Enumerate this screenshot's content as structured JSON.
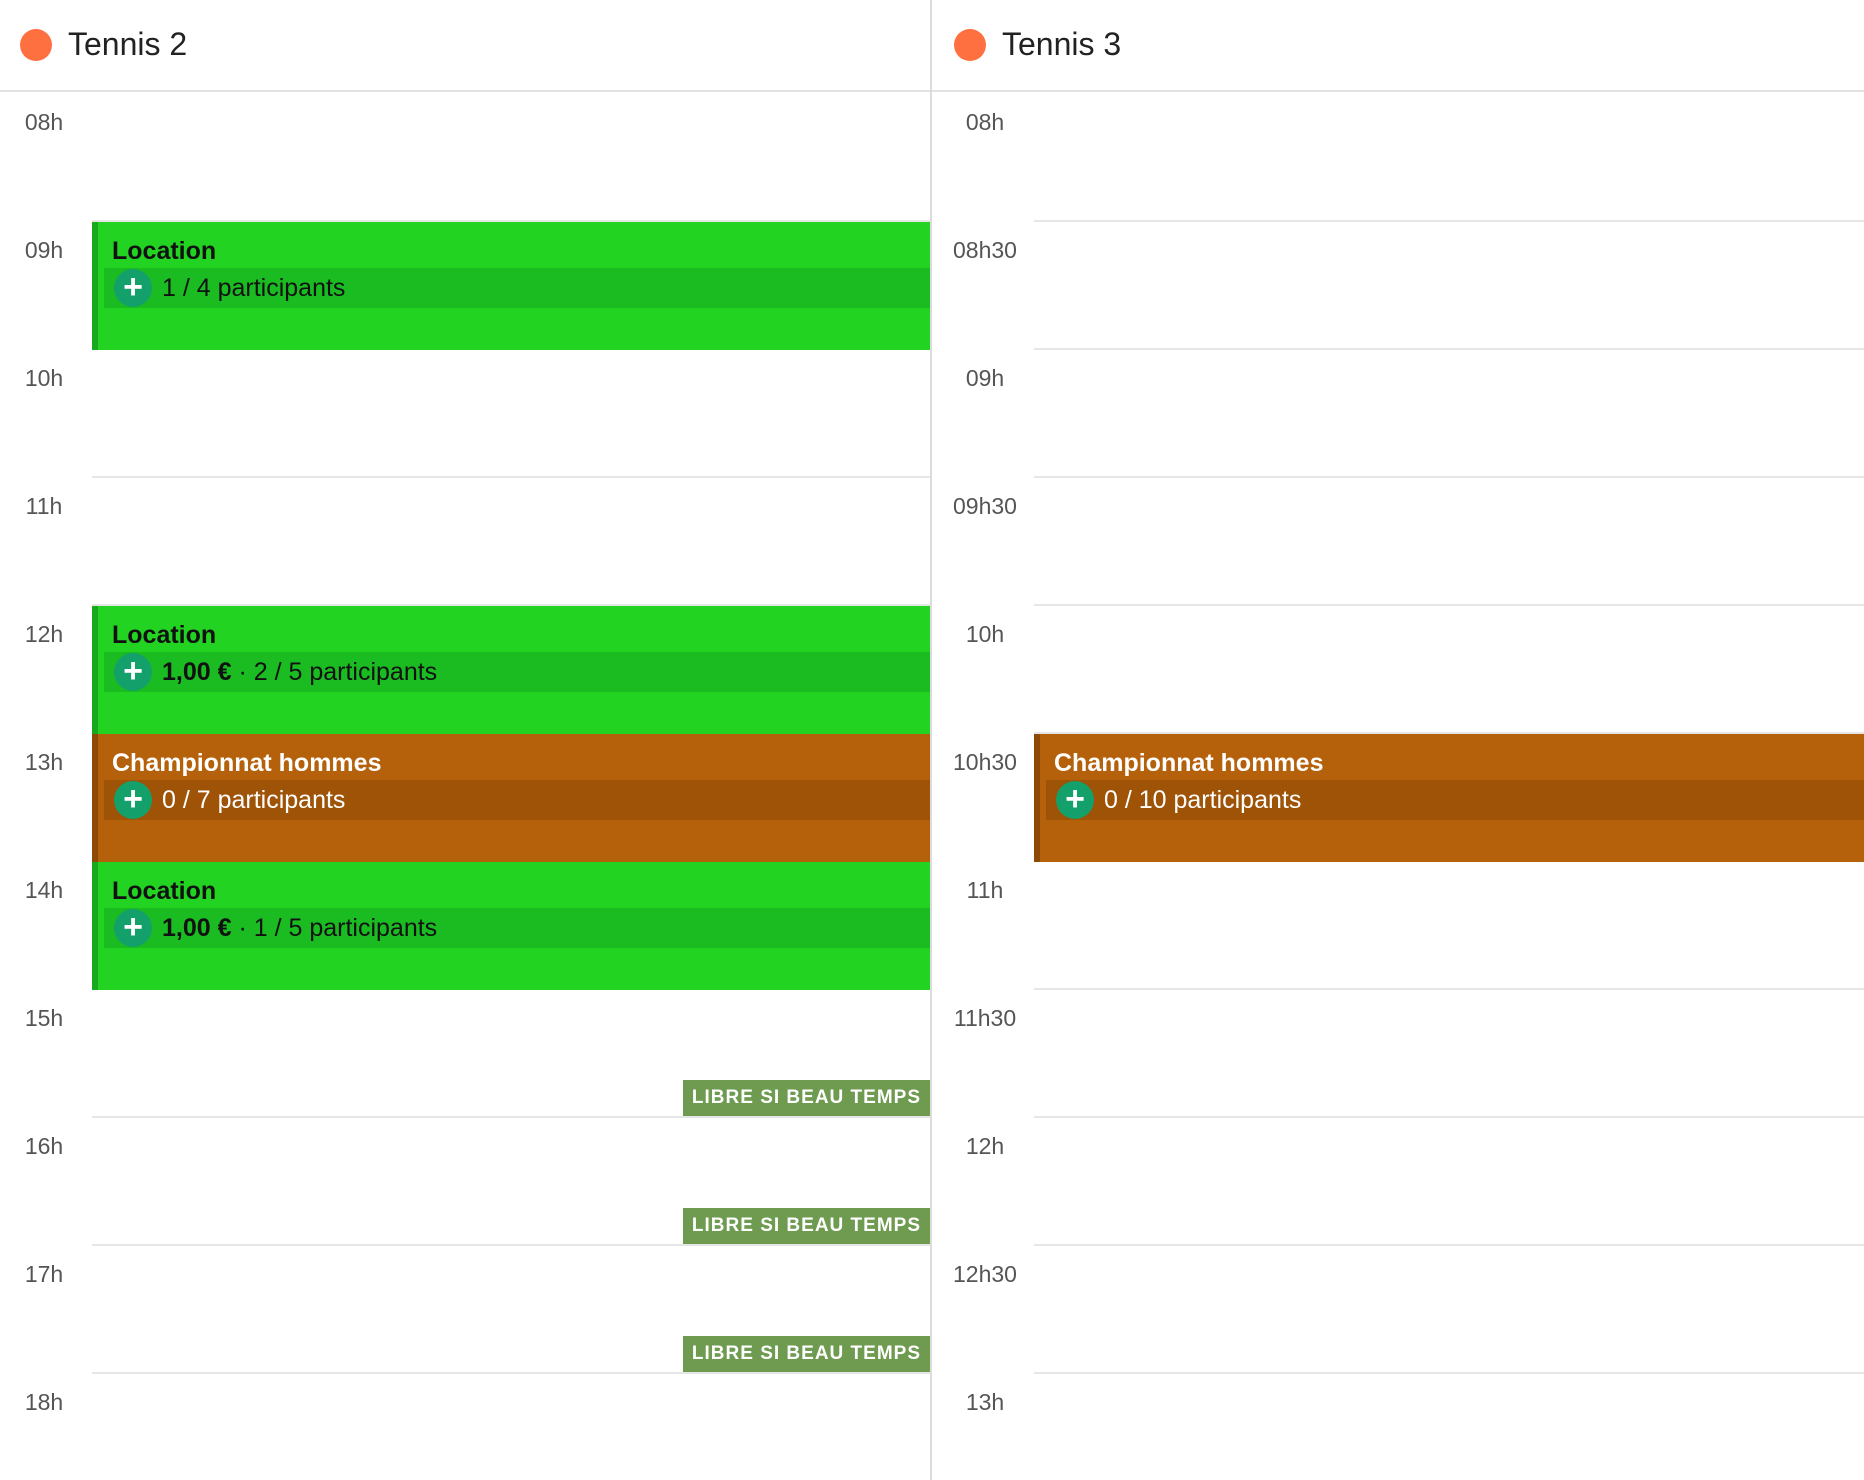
{
  "colors": {
    "resource_dot": "#ff7040",
    "location_bg": "#22d322",
    "location_row": "#1bbb22",
    "location_border": "#17a81e",
    "location_text": "#111111",
    "championnat_bg": "#b5600a",
    "championnat_row": "#9e5307",
    "championnat_border": "#8d4906",
    "championnat_text": "#ffffff",
    "badge_bg": "#6e9b50",
    "add_button": "#13a06a"
  },
  "columns": [
    {
      "name": "Tennis 2",
      "times": [
        "08h",
        "09h",
        "10h",
        "11h",
        "12h",
        "13h",
        "14h",
        "15h",
        "16h",
        "17h",
        "18h"
      ],
      "events": [
        {
          "kind": "location",
          "title": "Location",
          "price": "",
          "participants": "1 / 4 participants"
        },
        {
          "kind": "location",
          "title": "Location",
          "price": "1,00 €",
          "participants": " · 2 / 5 participants"
        },
        {
          "kind": "championnat",
          "title": "Championnat hommes",
          "price": "",
          "participants": "0 / 7 participants"
        },
        {
          "kind": "location",
          "title": "Location",
          "price": "1,00 €",
          "participants": " · 1 / 5 participants"
        }
      ],
      "badges": [
        "LIBRE SI BEAU TEMPS",
        "LIBRE SI BEAU TEMPS",
        "LIBRE SI BEAU TEMPS"
      ]
    },
    {
      "name": "Tennis 3",
      "times": [
        "08h",
        "08h30",
        "09h",
        "09h30",
        "10h",
        "10h30",
        "11h",
        "11h30",
        "12h",
        "12h30",
        "13h"
      ],
      "events": [
        {
          "kind": "championnat",
          "title": "Championnat hommes",
          "price": "",
          "participants": "0 / 10 participants"
        }
      ],
      "badges": []
    }
  ]
}
